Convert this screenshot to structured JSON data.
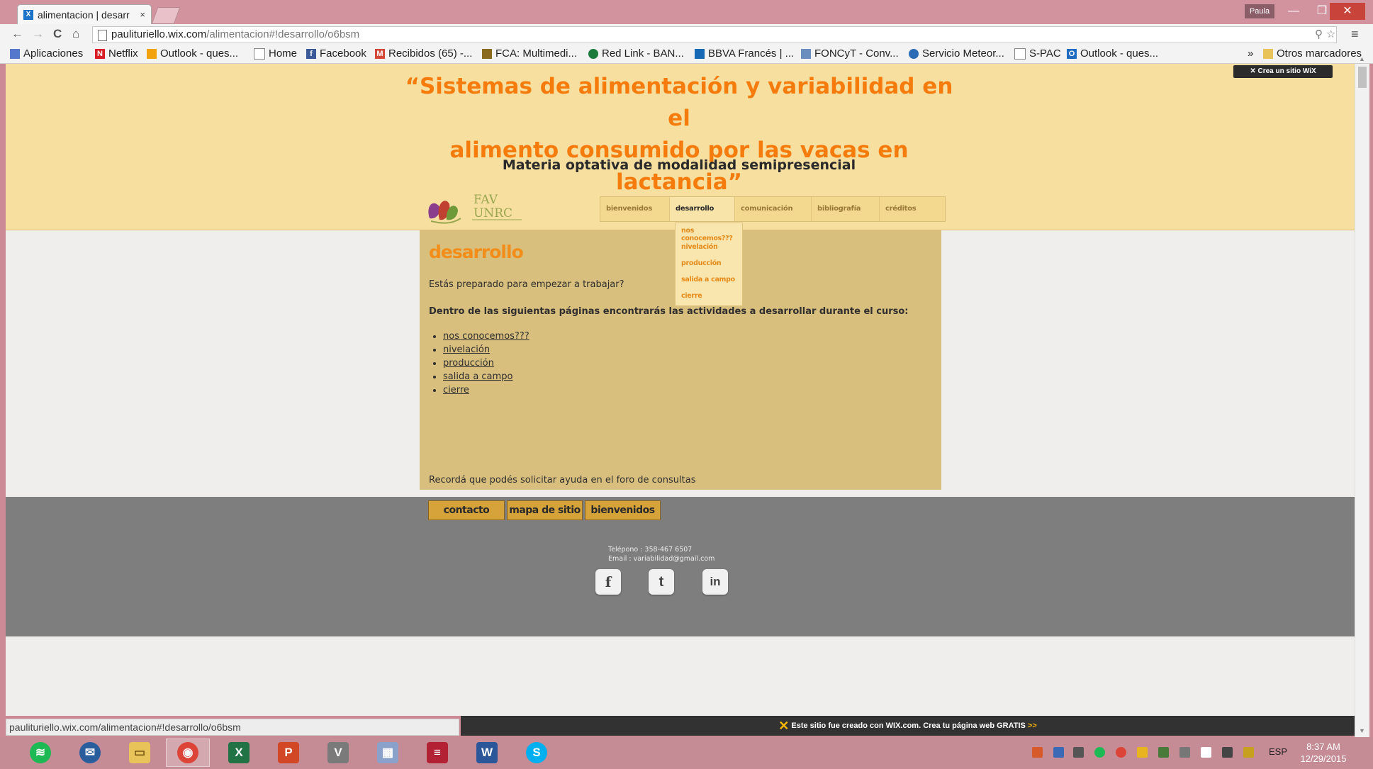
{
  "browser": {
    "tab_title": "alimentacion | desarr",
    "tab_close": "×",
    "user": "Paula",
    "win_min": "—",
    "win_max": "❐",
    "win_close": "✕",
    "back": "←",
    "forward": "→",
    "reload": "C",
    "home": "⌂",
    "url_host": "paulituriello.wix.com",
    "url_path": "/alimentacion#!desarrollo/o6bsm",
    "search_glyph": "⚲",
    "star_glyph": "☆",
    "menu_glyph": "≡"
  },
  "bookmarks": {
    "items": [
      {
        "label": "Aplicaciones",
        "icon": "apps-grid-icon",
        "color": "#5577cc"
      },
      {
        "label": "Netflix",
        "icon": "netflix-icon",
        "color": "#d81f26"
      },
      {
        "label": "Outlook - ques...",
        "icon": "windows-icon",
        "color": "#f2a10f"
      },
      {
        "label": "Home",
        "icon": "page-icon",
        "color": "#888888"
      },
      {
        "label": "Facebook",
        "icon": "facebook-icon",
        "color": "#3b5998"
      },
      {
        "label": "Recibidos (65) -...",
        "icon": "gmail-icon",
        "color": "#d34836"
      },
      {
        "label": "FCA: Multimedi...",
        "icon": "fca-icon",
        "color": "#8a6a1f"
      },
      {
        "label": "Red Link - BAN...",
        "icon": "redlink-icon",
        "color": "#1d7a3d"
      },
      {
        "label": "BBVA Francés | ...",
        "icon": "bbva-icon",
        "color": "#1769b5"
      },
      {
        "label": "FONCyT - Conv...",
        "icon": "foncyt-icon",
        "color": "#6a8fbf"
      },
      {
        "label": "Servicio Meteor...",
        "icon": "meteo-icon",
        "color": "#2a6cb5"
      },
      {
        "label": "S-PAC",
        "icon": "page-icon",
        "color": "#888888"
      },
      {
        "label": "Outlook - ques...",
        "icon": "outlook-icon",
        "color": "#1e6bc2"
      }
    ],
    "overflow": "»",
    "other": "Otros marcadores"
  },
  "site": {
    "crea_wix": "Crea un sitio WiX",
    "title_line1": "“Sistemas de alimentación y variabilidad  en  el",
    "title_line2": "alimento  consumido  por  las vacas  en  lactancia”",
    "subtitle": "Materia optativa de modalidad semipresencial",
    "logo_line1": "FAV",
    "logo_line2": "UNRC",
    "nav": [
      "bienvenidos",
      "desarrollo",
      "comunicación",
      "bibliografía",
      "créditos"
    ],
    "nav_active": "desarrollo",
    "dropdown": [
      "nos conocemos???",
      "nivelación",
      "producción",
      "salida a campo",
      "cierre"
    ],
    "content": {
      "heading": "desarrollo",
      "intro": "Estás preparado para empezar a trabajar?",
      "lead": "Dentro de las siguientas páginas encontrarás las actividades a desarrollar durante el curso:",
      "links": [
        "nos conocemos???",
        "nivelación",
        "producción",
        "salida a campo",
        "cierre"
      ],
      "help": "Recordá que podés solicitar ayuda en el foro de consultas"
    },
    "footer": {
      "buttons": [
        "contacto",
        "mapa de sitio",
        "bienvenidos"
      ],
      "phone": "Telépono : 358-467 6507",
      "email": "Email : variabilidad@gmail.com",
      "social": [
        "f",
        "t",
        "in"
      ]
    },
    "wix_banner": "Este sitio fue creado con WIX.com. Crea tu página web GRATIS",
    "wix_banner_arrow": ">>"
  },
  "status_url": "paulituriello.wix.com/alimentacion#!desarrollo/o6bsm",
  "taskbar": {
    "apps": [
      {
        "name": "spotify",
        "glyph": "≋",
        "color": "#1db954"
      },
      {
        "name": "thunderbird",
        "glyph": "✉",
        "color": "#2a5d9c"
      },
      {
        "name": "file-explorer",
        "glyph": "▭",
        "color": "#e8c35a"
      },
      {
        "name": "chrome",
        "glyph": "◉",
        "color": "#db4437"
      },
      {
        "name": "excel",
        "glyph": "X",
        "color": "#217346"
      },
      {
        "name": "powerpoint",
        "glyph": "P",
        "color": "#d24726"
      },
      {
        "name": "visual-studio",
        "glyph": "V",
        "color": "#7a7a7a"
      },
      {
        "name": "calculator",
        "glyph": "▦",
        "color": "#8aa2c9"
      },
      {
        "name": "language",
        "glyph": "≡",
        "color": "#b22234"
      },
      {
        "name": "word",
        "glyph": "W",
        "color": "#2b579a"
      },
      {
        "name": "skype",
        "glyph": "S",
        "color": "#00aff0"
      }
    ],
    "lang": "ESP",
    "time": "8:37 AM",
    "date": "12/29/2015"
  }
}
